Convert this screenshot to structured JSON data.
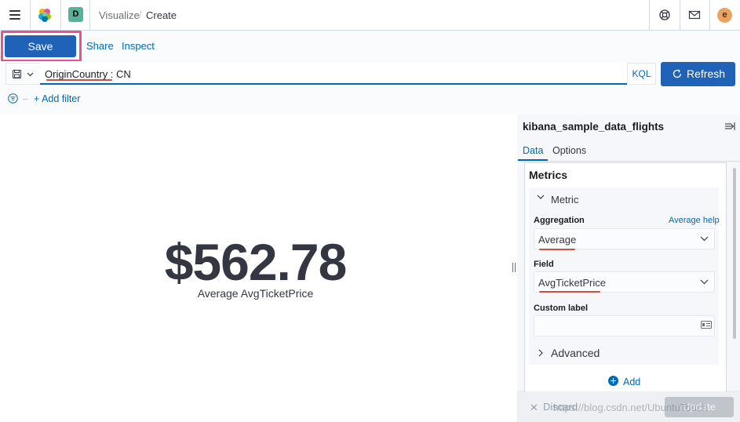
{
  "header": {
    "space_initial": "D",
    "breadcrumbs": [
      "Visualize",
      "Create"
    ],
    "breadcrumb_separator": "/",
    "user_initial": "e",
    "icons": [
      "menu-icon",
      "kibana-logo",
      "help-icon",
      "newsfeed-icon"
    ]
  },
  "top_nav": {
    "save_label": "Save",
    "share_label": "Share",
    "inspect_label": "Inspect"
  },
  "query_bar": {
    "query": "OriginCountry : CN",
    "language_label": "KQL",
    "refresh_label": "Refresh",
    "add_filter_label": "+ Add filter"
  },
  "visualization": {
    "metric_value": "$562.78",
    "metric_label": "Average AvgTicketPrice"
  },
  "sidebar": {
    "index_pattern": "kibana_sample_data_flights",
    "tabs": [
      {
        "label": "Data",
        "active": true
      },
      {
        "label": "Options",
        "active": false
      }
    ],
    "metrics_heading": "Metrics",
    "metric_title": "Metric",
    "aggregation_label": "Aggregation",
    "aggregation_help": "Average help",
    "aggregation_value": "Average",
    "field_label": "Field",
    "field_value": "AvgTicketPrice",
    "custom_label_label": "Custom label",
    "custom_label_value": "",
    "advanced_label": "Advanced",
    "add_label": "Add"
  },
  "bottom_bar": {
    "discard_label": "Discard",
    "update_label": "Update",
    "watermark": "https://blog.csdn.net/UbuntuTouch"
  },
  "colors": {
    "primary": "#1f62b7",
    "link": "#006bb4",
    "highlight_frame": "#e8538c",
    "annotation_underline": "#c8331f"
  }
}
